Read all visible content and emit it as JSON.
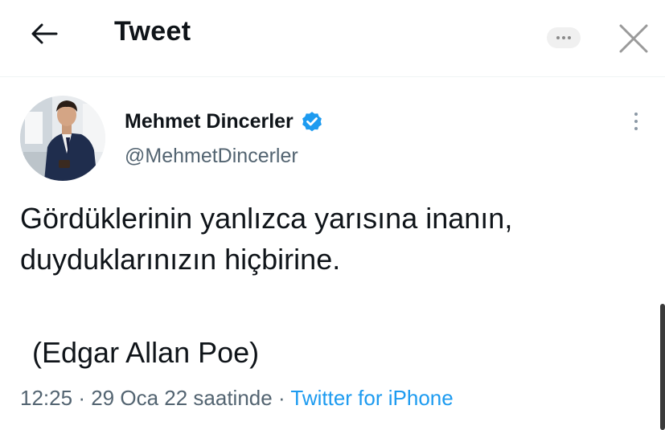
{
  "header": {
    "title": "Tweet",
    "back_icon": "arrow-left-icon",
    "more_icon": "more-horizontal-icon",
    "close_icon": "close-icon"
  },
  "author": {
    "display_name": "Mehmet Dincerler",
    "handle": "@MehmetDincerler",
    "verified": true,
    "verified_color": "#1d9bf0"
  },
  "tweet": {
    "lines": [
      "Gördüklerinin yanlızca yarısına inanın,",
      "duyduklarınızın hiçbirine."
    ],
    "quote": "(Edgar Allan Poe)",
    "time": "12:25",
    "separator": "·",
    "date": "29 Oca 22 saatinde",
    "source": "Twitter for iPhone"
  },
  "colors": {
    "text": "#0f1419",
    "secondary": "#536471",
    "link": "#1d9bf0"
  }
}
